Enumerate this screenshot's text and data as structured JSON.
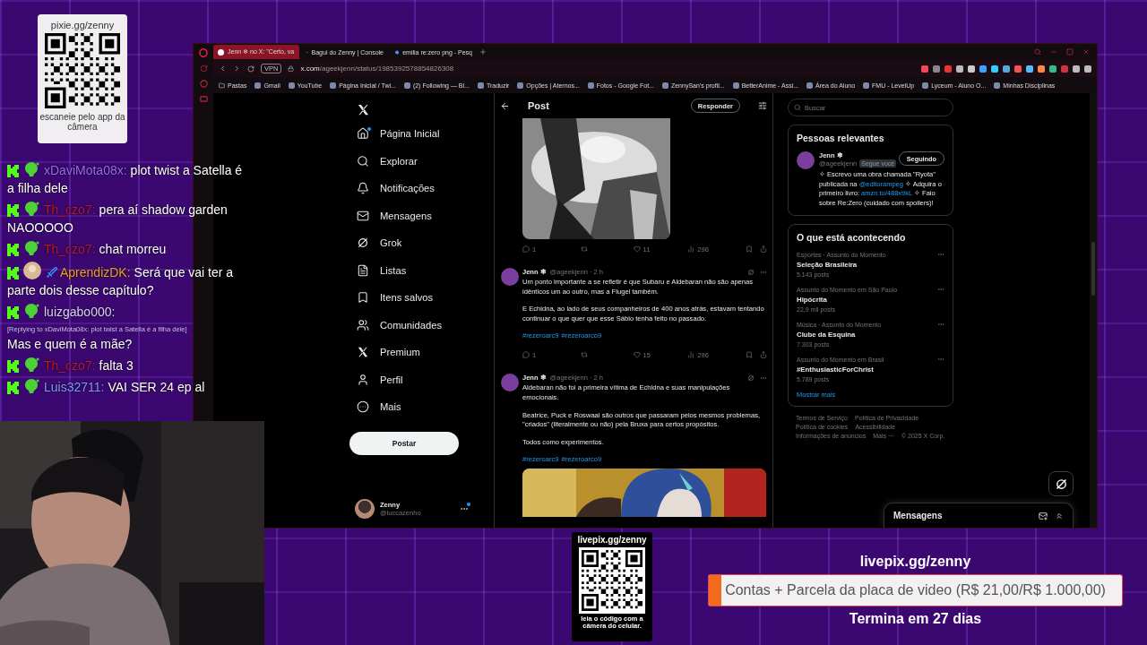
{
  "qr_card": {
    "url": "pixie.gg/zenny",
    "caption": "escaneie pelo app da câmera"
  },
  "chat": [
    {
      "user": "xDaviMota08x:",
      "color": "#9a6cf0",
      "message": "plot twist a Satella é a filha dele"
    },
    {
      "user": "Th_czo7:",
      "color": "#c3162a",
      "message": "pera aí shadow garden NAOOOOO"
    },
    {
      "user": "Th_czo7:",
      "color": "#c3162a",
      "message": "chat morreu"
    },
    {
      "user": "AprendizDK:",
      "color": "#f0a020",
      "message": "Será que vai ter a parte dois desse capítulo?"
    },
    {
      "user": "luizgabo000:",
      "color": "#d9d2f5",
      "reply": "[Replying to xDaviMota08x: plot twist a Satella é a filha dele]",
      "message": "Mas e quem é a mãe?"
    },
    {
      "user": "Th_czo7:",
      "color": "#c3162a",
      "message": "falta 3"
    },
    {
      "user": "Luis32711:",
      "color": "#7d9ef5",
      "message": "VAI SER 24 ep al"
    }
  ],
  "webcam": {
    "kind": "picture"
  },
  "browser": {
    "tabs": [
      {
        "title": "Jenn ❄ no X: \"Certo, va",
        "selected": true
      },
      {
        "title": "Bagui do Zenny | Console",
        "selected": false
      },
      {
        "title": "emilia re:zero png - Pesq",
        "selected": false
      }
    ],
    "vpn": "VPN",
    "url": "x.com/ageekjenn/status/1985392578854826308",
    "bookmarks": [
      "Pastas",
      "Gmail",
      "YouTube",
      "Página Inicial / Twi...",
      "(2) Following — Bl...",
      "Traduzir",
      "Opções | Aternos...",
      "Fotos - Google Fot...",
      "ZennySan's profil...",
      "BetterAnime - Assi...",
      "Área do Aluno",
      "FMU - LevelUp",
      "Lyceum - Aluno O...",
      "Minhas Disciplinas"
    ]
  },
  "nav": {
    "items": [
      {
        "label": "Página Inicial",
        "dot": true
      },
      {
        "label": "Explorar",
        "dot": false
      },
      {
        "label": "Notificações",
        "dot": false
      },
      {
        "label": "Mensagens",
        "dot": false
      },
      {
        "label": "Grok",
        "dot": false
      },
      {
        "label": "Listas",
        "dot": false
      },
      {
        "label": "Itens salvos",
        "dot": false
      },
      {
        "label": "Comunidades",
        "dot": false
      },
      {
        "label": "Premium",
        "dot": false
      },
      {
        "label": "Perfil",
        "dot": false
      },
      {
        "label": "Mais",
        "dot": false
      }
    ],
    "post_button": "Postar",
    "account": {
      "name": "Zenny",
      "handle": "@luccazenho",
      "dot": true
    }
  },
  "main": {
    "title": "Post",
    "reply_button": "Responder",
    "tweets": [
      {
        "media": {
          "kind": "picture"
        },
        "replies": "1",
        "likes": "11",
        "views": "296"
      },
      {
        "name": "Jenn ❄",
        "handle": "@ageekjenn · 2 h",
        "paragraphs": [
          "Um ponto importante a se refletir é que Subaru e Aldebaran não são apenas idênticos um ao outro, mas a Flugel também.",
          "E Echidna, ao lado de seus companheiros de 400 anos atrás, estavam tentando continuar o que quer que esse Sábio tenha feito no passado."
        ],
        "hashtags": [
          "#rezeroarc9",
          "#rezeroarco9"
        ],
        "replies": "1",
        "likes": "15",
        "views": "296"
      },
      {
        "name": "Jenn ❄",
        "handle": "@ageekjenn · 2 h",
        "paragraphs": [
          "Aldebaran não foi a primeira vítima de Echidna e suas manipulações emocionais.",
          "Beatrice, Puck e Roswaal são outros que passaram pelos mesmos problemas, \"criados\" (literalmente ou não) pela Bruxa para certos propósitos.",
          "Todos como experimentos."
        ],
        "hashtags": [
          "#rezeroarc9",
          "#rezeroarco9"
        ],
        "media": {
          "kind": "picture"
        }
      }
    ]
  },
  "right": {
    "search": {
      "placeholder": "Buscar"
    },
    "people": {
      "title": "Pessoas relevantes",
      "name": "Jenn ❄",
      "handle": "@ageekjenn",
      "follows_you": "Segue você",
      "button": "Seguindo",
      "bio": [
        {
          "kind": "text",
          "text": "✧ Escrevo uma obra chamada \"Ryota\" publicada na "
        },
        {
          "kind": "link",
          "text": "@editorampeg"
        },
        {
          "kind": "text",
          "text": " ✧ Adquira o primeiro livro: "
        },
        {
          "kind": "link",
          "text": "amzn.to/488x9kL"
        },
        {
          "kind": "text",
          "text": " ✧ Falo sobre Re:Zero (cuidado com spoilers)!"
        }
      ]
    },
    "trends": {
      "title": "O que está acontecendo",
      "items": [
        {
          "context": "Esportes · Assunto do Momento",
          "topic": "Seleção Brasileira",
          "count": "5.143 posts"
        },
        {
          "context": "Assunto do Momento em São Paulo",
          "topic": "Hipócrita",
          "count": "22,9 mil posts"
        },
        {
          "context": "Música · Assunto do Momento",
          "topic": "Clube da Esquina",
          "count": "7.303 posts"
        },
        {
          "context": "Assunto do Momento em Brasil",
          "topic": "#EnthusiasticForChrist",
          "count": "5.789 posts"
        }
      ],
      "more": "Mostrar mais"
    },
    "footer": [
      "Termos de Serviço",
      "Política de Privacidade",
      "Política de cookies",
      "Acessibilidade",
      "Informações de anúncios",
      "Mais ···",
      "© 2025 X Corp."
    ],
    "messages": "Mensagens"
  },
  "livepix": {
    "qr_url": "livepix.gg/zenny",
    "qr_caption": "leia o código com a câmera do celular.",
    "url": "livepix.gg/zenny",
    "goal": "Contas + Parcela da placa de video (R$ 21,00/R$ 1.000,00)",
    "level": 0.021,
    "ends": "Termina em 27 dias"
  }
}
